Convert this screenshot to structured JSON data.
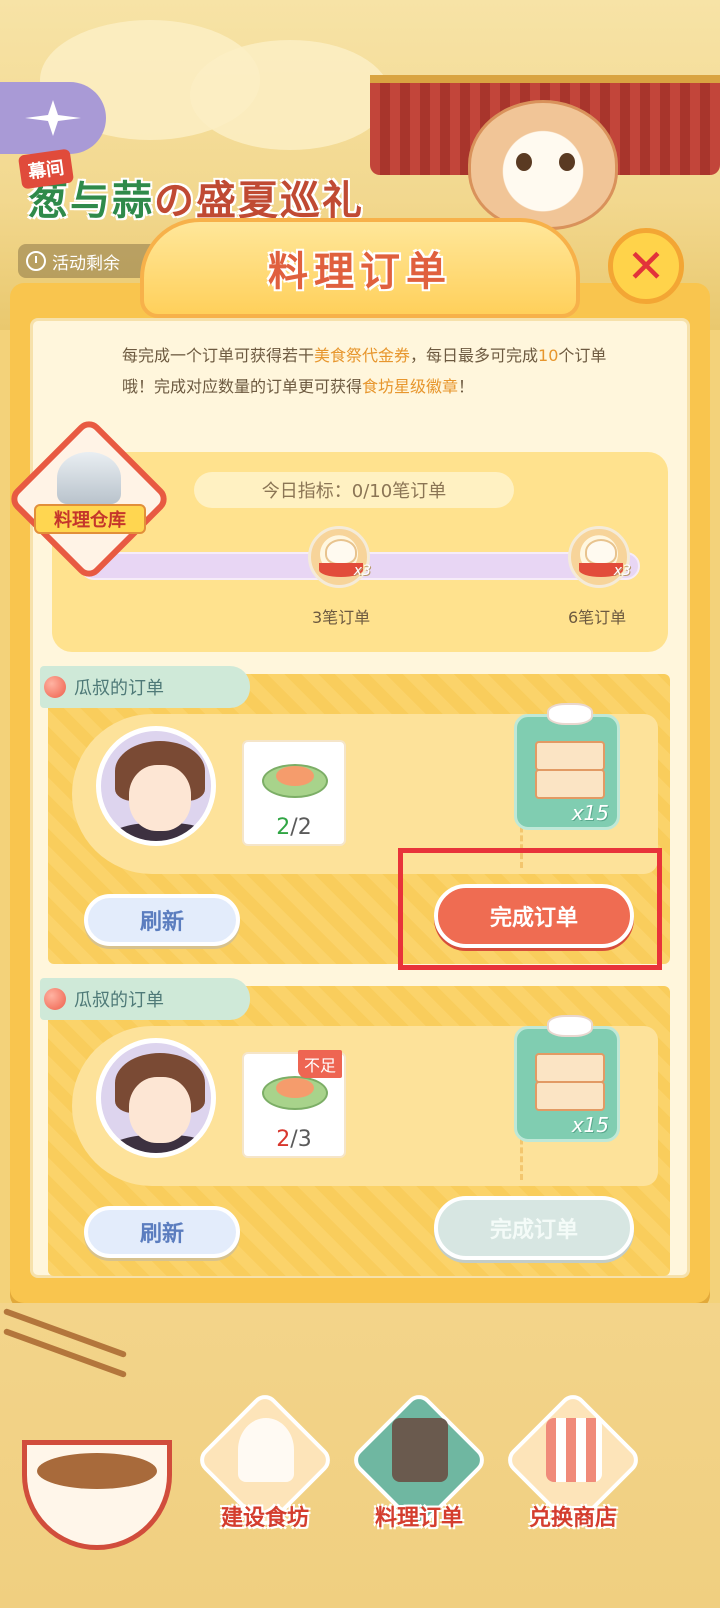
{
  "event": {
    "tag": "幕间",
    "title_part1": "葱与蒜",
    "title_part2": "の盛夏巡礼",
    "remaining_label": "活动剩余"
  },
  "dialog": {
    "title": "料理订单",
    "close_icon": "close-icon",
    "description": {
      "p1": "每完成一个订单可获得若干",
      "hl1": "美食祭代金券",
      "p2": "，每日最多可完成",
      "hl2": "10",
      "p3": "个订单哦！完成对应数量的订单更可获得",
      "hl3": "食坊星级徽章",
      "p4": "！"
    }
  },
  "warehouse": {
    "label": "料理仓库"
  },
  "progress": {
    "daily_target": "今日指标：0/10笔订单",
    "milestones": [
      {
        "label": "3笔订单",
        "count": "x3"
      },
      {
        "label": "6笔订单",
        "count": "x3"
      }
    ]
  },
  "orders": [
    {
      "customer": "瓜叔的订单",
      "dish_have": "2",
      "dish_need": "2",
      "sufficient": true,
      "reward_count": "x15",
      "refresh_label": "刷新",
      "complete_label": "完成订单"
    },
    {
      "customer": "瓜叔的订单",
      "dish_have": "2",
      "dish_need": "3",
      "sufficient": false,
      "lack_badge": "不足",
      "reward_count": "x15",
      "refresh_label": "刷新",
      "complete_label": "完成订单"
    }
  ],
  "bottom_nav": [
    {
      "label": "建设食坊"
    },
    {
      "label": "料理订单"
    },
    {
      "label": "兑换商店"
    }
  ],
  "colors": {
    "accent": "#ef6c52",
    "panel": "#f9c54e",
    "highlight": "#e8333a"
  }
}
